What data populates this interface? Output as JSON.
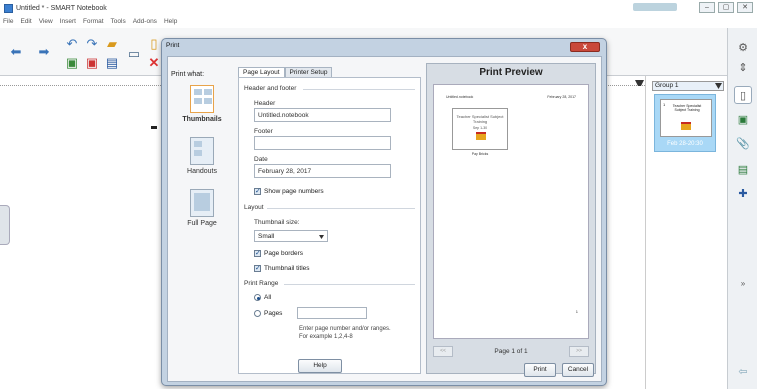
{
  "window": {
    "title": "Untitled * - SMART Notebook",
    "controls": [
      "–",
      "▢",
      "✕"
    ]
  },
  "menu": [
    "File",
    "Edit",
    "View",
    "Insert",
    "Format",
    "Tools",
    "Add-ons",
    "Help"
  ],
  "page_sorter": {
    "group": "Group 1",
    "thumbnail_time": "Feb 28-20:30",
    "thumbnail_number": "1",
    "thumbnail_title": "Teacher Specialist Subject Training"
  },
  "dialog": {
    "title": "Print",
    "close": "x",
    "print_what_label": "Print what:",
    "print_what_items": [
      {
        "label": "Thumbnails"
      },
      {
        "label": "Handouts"
      },
      {
        "label": "Full Page"
      }
    ],
    "tabs": [
      "Page Layout",
      "Printer Setup"
    ],
    "header_footer_section": "Header and footer",
    "header_label": "Header",
    "header_value": "Untitled.notebook",
    "footer_label": "Footer",
    "footer_value": "",
    "date_label": "Date",
    "date_value": "February 28, 2017",
    "show_page_numbers": "Show page numbers",
    "layout_section": "Layout",
    "thumbnail_size_label": "Thumbnail size:",
    "thumbnail_size_value": "Small",
    "page_borders": "Page borders",
    "thumbnail_titles": "Thumbnail titles",
    "print_range_section": "Print Range",
    "range_all": "All",
    "range_pages": "Pages",
    "pages_value": "",
    "pages_hint_1": "Enter page number and/or ranges.",
    "pages_hint_2": "For example 1,2,4-8",
    "help_button": "Help",
    "preview_title": "Print Preview",
    "preview_header_left": "Untitled.notebook",
    "preview_header_right": "February 28, 2017",
    "preview_thumb_text": "Teacher Specialist Subject Training",
    "preview_thumb_date": "Sep 1-30",
    "preview_caption": "Pay Bricks",
    "preview_page_number": "1",
    "prev_button": "<<",
    "next_button": ">>",
    "page_of": "Page 1 of 1",
    "print_button": "Print",
    "cancel_button": "Cancel"
  }
}
